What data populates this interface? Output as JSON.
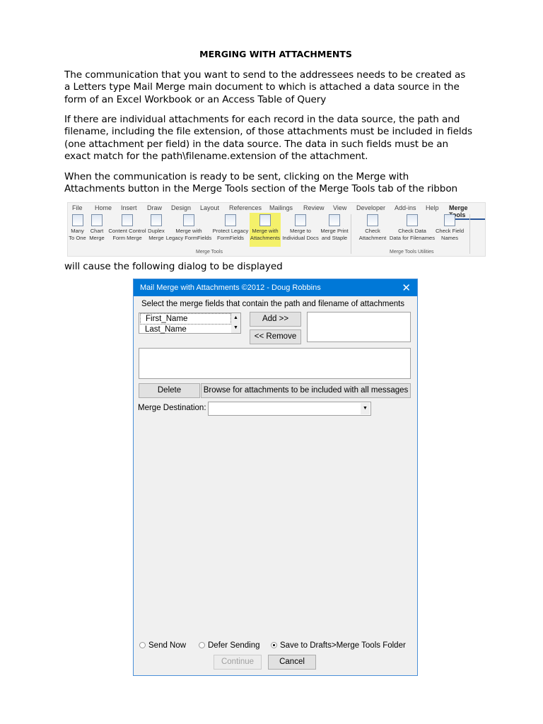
{
  "heading": "MERGING WITH ATTACHMENTS",
  "paragraphs": [
    [
      "The communication that you want to send to the addressees needs to be created as",
      "a Letters type Mail Merge main document to which is attached a data source in the",
      "form of an Excel Workbook or an Access Table of Query"
    ],
    [
      "If there are individual attachments for each record in the data source, the path and",
      "filename, including the file extension, of those attachments must be included in fields",
      "(one attachment per field) in the data source.  The data in such fields must be an",
      "exact match for the path\\filename.extension of the attachment."
    ],
    [
      "When the communication is ready to be sent, clicking on the Merge with",
      "Attachments button in the Merge Tools section of the Merge Tools tab of the ribbon"
    ],
    [
      "will cause the following dialog to be displayed"
    ]
  ],
  "ribbon": {
    "tabs": [
      "File",
      "Home",
      "Insert",
      "Draw",
      "Design",
      "Layout",
      "References",
      "Mailings",
      "Review",
      "View",
      "Developer",
      "Add-ins",
      "Help",
      "Merge Tools"
    ],
    "buttons": [
      [
        "Many",
        "To One"
      ],
      [
        "Chart",
        "Merge"
      ],
      [
        "Content Control",
        "Form Merge"
      ],
      [
        "Duplex",
        "Merge"
      ],
      [
        "Merge with",
        "Legacy FormFields"
      ],
      [
        "Protect Legacy",
        "FormFields"
      ],
      [
        "Merge with",
        "Attachments"
      ],
      [
        "Merge to",
        "Individual Docs"
      ],
      [
        "Merge Print",
        "and Staple"
      ],
      [
        "Check",
        "Attachment"
      ],
      [
        "Check Data",
        "Data for Filenames"
      ],
      [
        "Check Field",
        "Names"
      ]
    ],
    "groups": [
      "Merge Tools",
      "Merge Tools Utilities"
    ],
    "highlight": "#f4f16a"
  },
  "dialog": {
    "title": "Mail Merge with Attachments ©2012 - Doug Robbins",
    "instruction": "Select the merge fields that contain the path and filename of attachments",
    "fields": [
      "First_Name",
      "Last_Name"
    ],
    "add": "Add >>",
    "remove": "<< Remove",
    "delete": "Delete",
    "browse": "Browse for attachments to be included with all messages",
    "destination_label": "Merge Destination:",
    "destination_value": "",
    "radios": [
      {
        "label": "Send Now",
        "checked": false
      },
      {
        "label": "Defer Sending",
        "checked": false
      },
      {
        "label": "Save to Drafts>Merge Tools Folder",
        "checked": true
      }
    ],
    "continue": "Continue",
    "cancel": "Cancel",
    "title_color": "#0078d7"
  }
}
